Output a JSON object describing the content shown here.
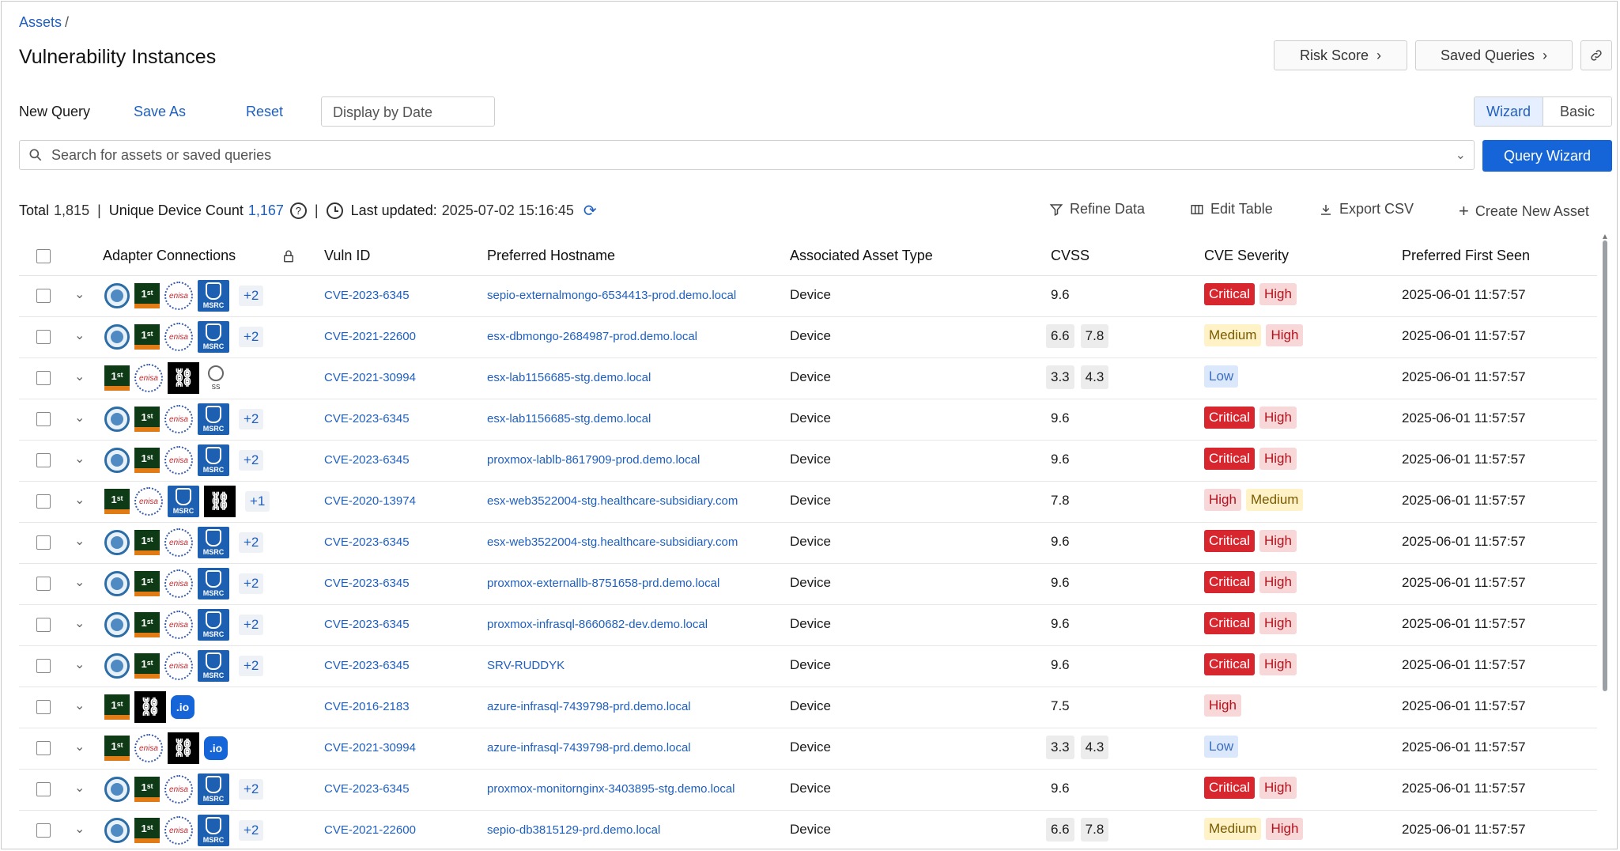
{
  "breadcrumb": {
    "root": "Assets",
    "separator": "/"
  },
  "page_title": "Vulnerability Instances",
  "header_buttons": {
    "risk_score": "Risk Score",
    "saved_queries": "Saved Queries",
    "link_icon": "link-icon"
  },
  "query_toolbar": {
    "new_query": "New Query",
    "save_as": "Save As",
    "reset": "Reset",
    "display_by_date": "Display by Date",
    "mode_wizard": "Wizard",
    "mode_basic": "Basic",
    "active_mode": "Wizard"
  },
  "search": {
    "placeholder": "Search for assets or saved queries",
    "query_wizard": "Query Wizard"
  },
  "stats": {
    "total_label": "Total",
    "total_value": "1,815",
    "unique_label": "Unique Device Count",
    "unique_value": "1,167",
    "last_updated_label": "Last updated:",
    "last_updated_value": "2025-07-02 15:16:45"
  },
  "table_actions": {
    "refine": "Refine Data",
    "edit_table": "Edit Table",
    "export": "Export CSV",
    "create": "Create New Asset"
  },
  "columns": {
    "adapters": "Adapter Connections",
    "vuln_id": "Vuln ID",
    "hostname": "Preferred Hostname",
    "asset_type": "Associated Asset Type",
    "cvss": "CVSS",
    "severity": "CVE Severity",
    "first_seen": "Preferred First Seen"
  },
  "colors": {
    "accent": "#1565d8",
    "critical": "#d8262f",
    "high_bg": "#f8d7d9",
    "medium_bg": "#fff2c7",
    "low_bg": "#dbe8fb"
  },
  "rows": [
    {
      "adapters": [
        "globe",
        "first",
        "enisa",
        "msrc"
      ],
      "more": "+2",
      "vuln_id": "CVE-2023-6345",
      "hostname": "sepio-externalmongo-6534413-prod.demo.local",
      "asset_type": "Device",
      "cvss": [
        "9.6"
      ],
      "severity": [
        "Critical",
        "High"
      ],
      "first_seen": "2025-06-01 11:57:57"
    },
    {
      "adapters": [
        "globe",
        "first",
        "enisa",
        "msrc"
      ],
      "more": "+2",
      "vuln_id": "CVE-2021-22600",
      "hostname": "esx-dbmongo-2684987-prod.demo.local",
      "asset_type": "Device",
      "cvss": [
        "6.6",
        "7.8"
      ],
      "severity": [
        "Medium",
        "High"
      ],
      "first_seen": "2025-06-01 11:57:57"
    },
    {
      "adapters": [
        "first",
        "enisa",
        "chain",
        "ss"
      ],
      "more": "",
      "vuln_id": "CVE-2021-30994",
      "hostname": "esx-lab1156685-stg.demo.local",
      "asset_type": "Device",
      "cvss": [
        "3.3",
        "4.3"
      ],
      "severity": [
        "Low"
      ],
      "first_seen": "2025-06-01 11:57:57"
    },
    {
      "adapters": [
        "globe",
        "first",
        "enisa",
        "msrc"
      ],
      "more": "+2",
      "vuln_id": "CVE-2023-6345",
      "hostname": "esx-lab1156685-stg.demo.local",
      "asset_type": "Device",
      "cvss": [
        "9.6"
      ],
      "severity": [
        "Critical",
        "High"
      ],
      "first_seen": "2025-06-01 11:57:57"
    },
    {
      "adapters": [
        "globe",
        "first",
        "enisa",
        "msrc"
      ],
      "more": "+2",
      "vuln_id": "CVE-2023-6345",
      "hostname": "proxmox-lablb-8617909-prod.demo.local",
      "asset_type": "Device",
      "cvss": [
        "9.6"
      ],
      "severity": [
        "Critical",
        "High"
      ],
      "first_seen": "2025-06-01 11:57:57"
    },
    {
      "adapters": [
        "first",
        "enisa",
        "msrc",
        "chain"
      ],
      "more": "+1",
      "vuln_id": "CVE-2020-13974",
      "hostname": "esx-web3522004-stg.healthcare-subsidiary.com",
      "asset_type": "Device",
      "cvss": [
        "7.8"
      ],
      "severity": [
        "High",
        "Medium"
      ],
      "first_seen": "2025-06-01 11:57:57"
    },
    {
      "adapters": [
        "globe",
        "first",
        "enisa",
        "msrc"
      ],
      "more": "+2",
      "vuln_id": "CVE-2023-6345",
      "hostname": "esx-web3522004-stg.healthcare-subsidiary.com",
      "asset_type": "Device",
      "cvss": [
        "9.6"
      ],
      "severity": [
        "Critical",
        "High"
      ],
      "first_seen": "2025-06-01 11:57:57"
    },
    {
      "adapters": [
        "globe",
        "first",
        "enisa",
        "msrc"
      ],
      "more": "+2",
      "vuln_id": "CVE-2023-6345",
      "hostname": "proxmox-externallb-8751658-prd.demo.local",
      "asset_type": "Device",
      "cvss": [
        "9.6"
      ],
      "severity": [
        "Critical",
        "High"
      ],
      "first_seen": "2025-06-01 11:57:57"
    },
    {
      "adapters": [
        "globe",
        "first",
        "enisa",
        "msrc"
      ],
      "more": "+2",
      "vuln_id": "CVE-2023-6345",
      "hostname": "proxmox-infrasql-8660682-dev.demo.local",
      "asset_type": "Device",
      "cvss": [
        "9.6"
      ],
      "severity": [
        "Critical",
        "High"
      ],
      "first_seen": "2025-06-01 11:57:57"
    },
    {
      "adapters": [
        "globe",
        "first",
        "enisa",
        "msrc"
      ],
      "more": "+2",
      "vuln_id": "CVE-2023-6345",
      "hostname": "SRV-RUDDYK",
      "asset_type": "Device",
      "cvss": [
        "9.6"
      ],
      "severity": [
        "Critical",
        "High"
      ],
      "first_seen": "2025-06-01 11:57:57"
    },
    {
      "adapters": [
        "first",
        "chain",
        "io"
      ],
      "more": "",
      "vuln_id": "CVE-2016-2183",
      "hostname": "azure-infrasql-7439798-prd.demo.local",
      "asset_type": "Device",
      "cvss": [
        "7.5"
      ],
      "severity": [
        "High"
      ],
      "first_seen": "2025-06-01 11:57:57"
    },
    {
      "adapters": [
        "first",
        "enisa",
        "chain",
        "io"
      ],
      "more": "",
      "vuln_id": "CVE-2021-30994",
      "hostname": "azure-infrasql-7439798-prd.demo.local",
      "asset_type": "Device",
      "cvss": [
        "3.3",
        "4.3"
      ],
      "severity": [
        "Low"
      ],
      "first_seen": "2025-06-01 11:57:57"
    },
    {
      "adapters": [
        "globe",
        "first",
        "enisa",
        "msrc"
      ],
      "more": "+2",
      "vuln_id": "CVE-2023-6345",
      "hostname": "proxmox-monitornginx-3403895-stg.demo.local",
      "asset_type": "Device",
      "cvss": [
        "9.6"
      ],
      "severity": [
        "Critical",
        "High"
      ],
      "first_seen": "2025-06-01 11:57:57"
    },
    {
      "adapters": [
        "globe",
        "first",
        "enisa",
        "msrc"
      ],
      "more": "+2",
      "vuln_id": "CVE-2021-22600",
      "hostname": "sepio-db3815129-prd.demo.local",
      "asset_type": "Device",
      "cvss": [
        "6.6",
        "7.8"
      ],
      "severity": [
        "Medium",
        "High"
      ],
      "first_seen": "2025-06-01 11:57:57"
    }
  ]
}
